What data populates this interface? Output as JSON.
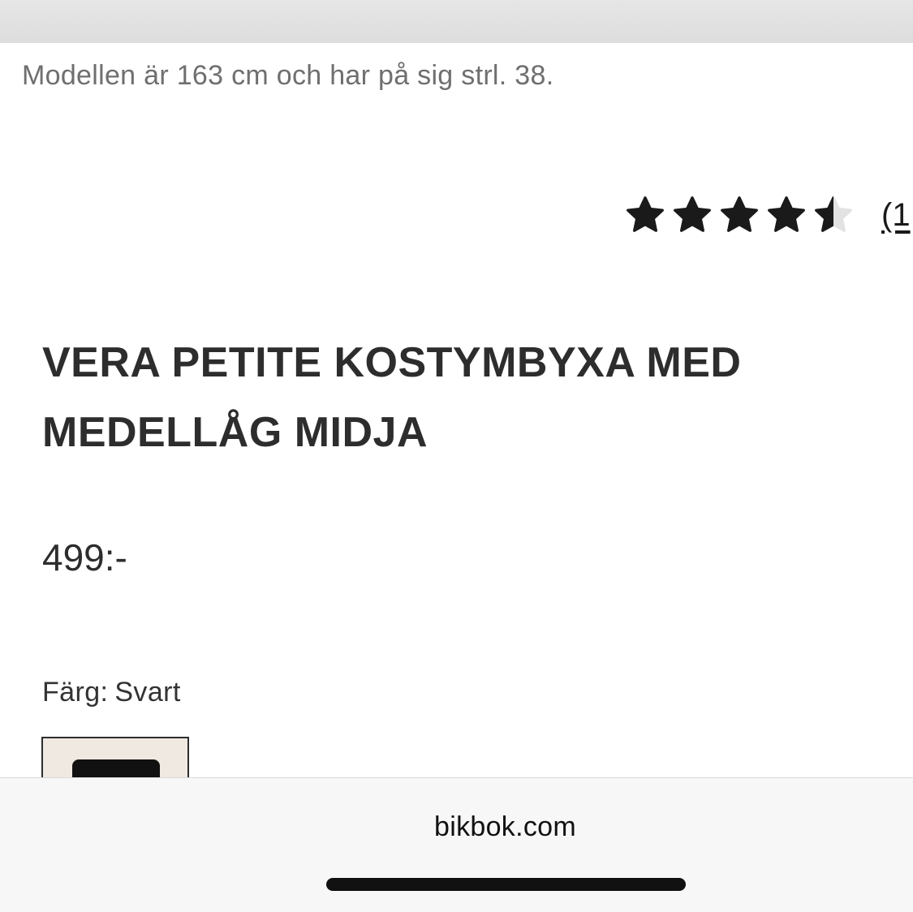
{
  "product": {
    "model_note": "Modellen är 163 cm och har på sig strl. 38.",
    "rating": {
      "value": 4.5,
      "max": 5,
      "review_count_label": "(1",
      "filled_color": "#1a1a1a",
      "empty_color": "#e2e2e2"
    },
    "title_line1": "VERA PETITE KOSTYMBYXA MED",
    "title_line2": "MEDELLÅG MIDJA",
    "price": "499:-",
    "color": {
      "label": "Färg:",
      "value": "Svart"
    }
  },
  "browser": {
    "url": "bikbok.com"
  }
}
